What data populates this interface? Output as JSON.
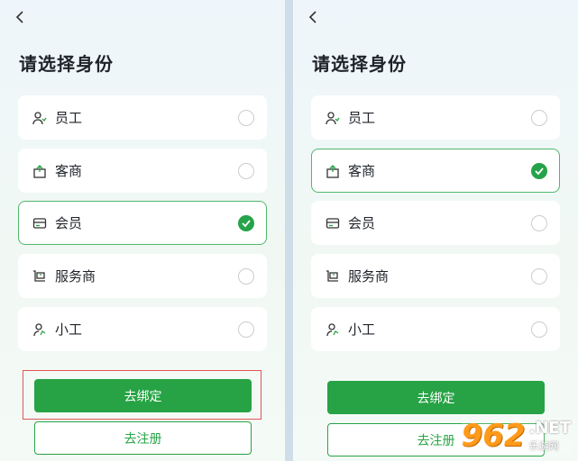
{
  "title": "请选择身份",
  "options": [
    {
      "label": "员工",
      "icon": "user-hand-icon"
    },
    {
      "label": "客商",
      "icon": "shop-box-icon"
    },
    {
      "label": "会员",
      "icon": "card-icon"
    },
    {
      "label": "服务商",
      "icon": "service-cart-icon"
    },
    {
      "label": "小工",
      "icon": "worker-icon"
    }
  ],
  "selected_left": "会员",
  "selected_right": "客商",
  "bind_button": "去绑定",
  "register_button": "去注册",
  "watermark": {
    "logo": "962",
    "net": ".NET",
    "site": "乐游网"
  },
  "colors": {
    "primary": "#27a345",
    "selected_border": "#4fb86a",
    "highlight": "#e05555"
  }
}
